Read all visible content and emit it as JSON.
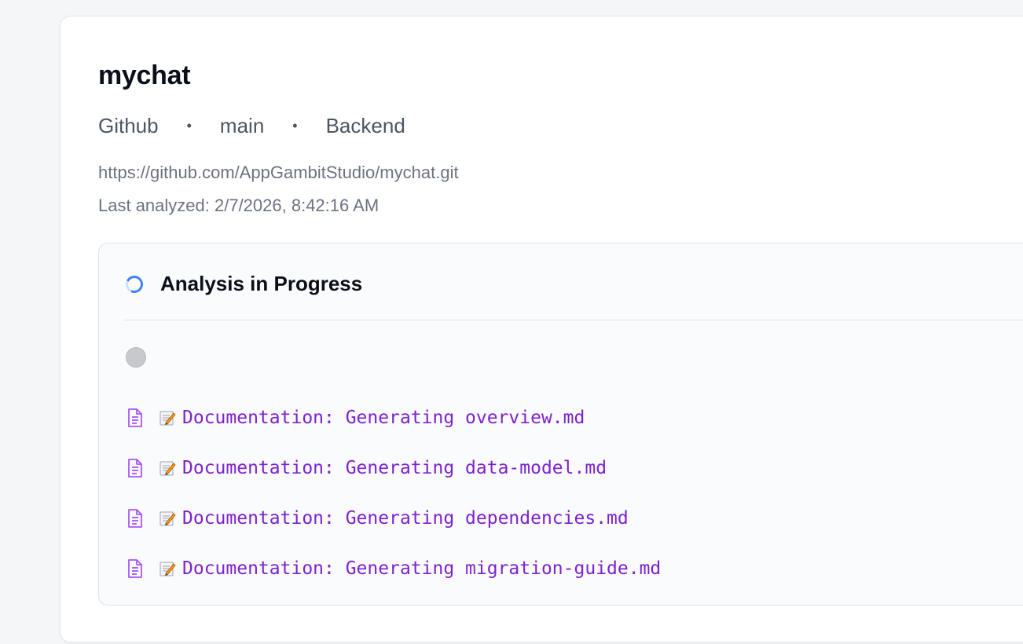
{
  "repo": {
    "name": "mychat",
    "source": "Github",
    "branch": "main",
    "type": "Backend",
    "url": "https://github.com/AppGambitStudio/mychat.git",
    "last_analyzed": "Last analyzed: 2/7/2026, 8:42:16 AM",
    "separator": "•"
  },
  "analysis": {
    "title": "Analysis in Progress",
    "spinner_icon": "spinner-icon",
    "pending_icon": "pending-dot",
    "log_icon": "document-icon",
    "memo_icon": "memo-icon",
    "accent_color": "#3b82f6",
    "log_color": "#7e22ce",
    "logs": [
      "Documentation: Generating overview.md",
      "Documentation: Generating data-model.md",
      "Documentation: Generating dependencies.md",
      "Documentation: Generating migration-guide.md"
    ]
  }
}
